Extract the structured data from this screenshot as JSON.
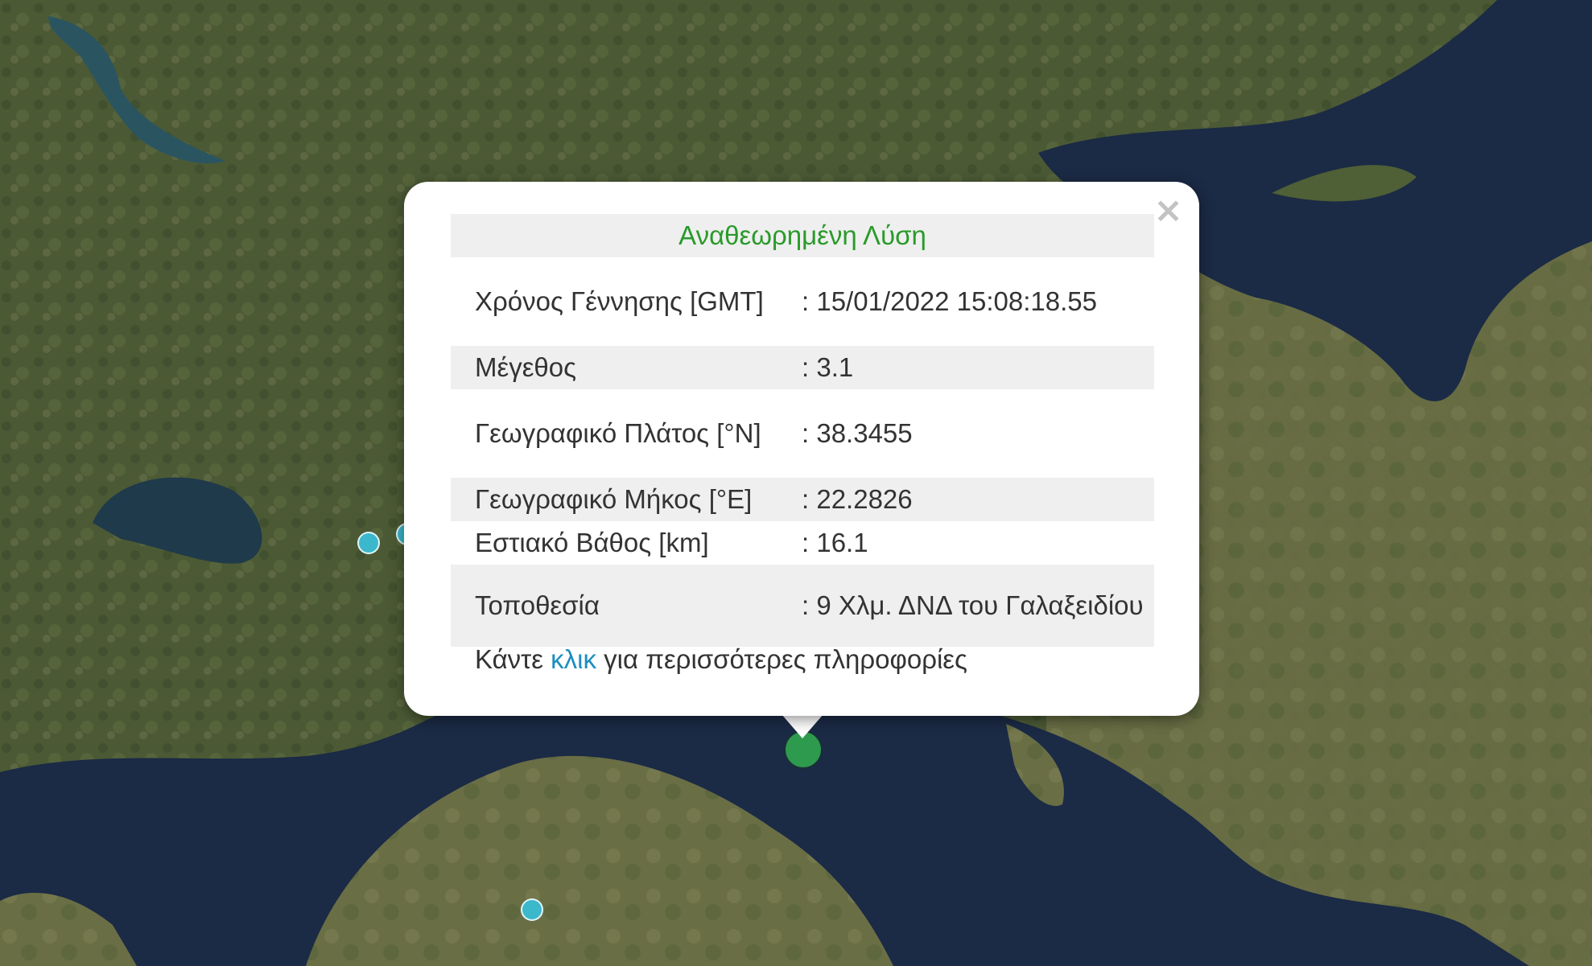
{
  "map": {
    "colors": {
      "sea": "#1b2a45",
      "land_dark": "#3a4a2a",
      "land_light": "#6b7a4a",
      "marker_cyan": "#3bb8cc",
      "marker_green": "#2e9a4e"
    }
  },
  "popup": {
    "close_icon": "close-icon",
    "title": "Αναθεωρημένη Λύση",
    "rows": [
      {
        "label": "Χρόνος Γέννησης [GMT]",
        "value": ": 15/01/2022 15:08:18.55"
      },
      {
        "label": "Μέγεθος",
        "value": ": 3.1"
      },
      {
        "label": "Γεωγραφικό Πλάτος [°N]",
        "value": ": 38.3455"
      },
      {
        "label": "Γεωγραφικό Μήκος [°E]",
        "value": ": 22.2826"
      },
      {
        "label": "Εστιακό Βάθος [km]",
        "value": ": 16.1"
      },
      {
        "label": "Τοποθεσία",
        "value": ": 9 Χλμ. ΔΝΔ του Γαλαξειδίου"
      }
    ],
    "footer": {
      "before": "Κάντε ",
      "link": "κλικ",
      "after": " για περισσότερες πληροφορίες"
    }
  }
}
